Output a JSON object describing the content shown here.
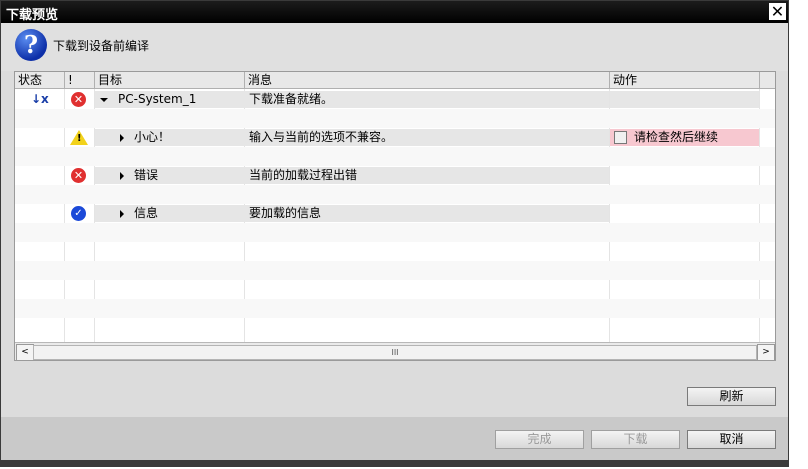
{
  "window": {
    "title": "下载预览",
    "close_glyph": "✕"
  },
  "header": {
    "text": "下载到设备前编译",
    "icon": "question-icon",
    "icon_glyph": "?"
  },
  "table": {
    "columns": [
      "状态",
      "!",
      "目标",
      "消息",
      "动作"
    ],
    "rows": [
      {
        "target": "PC-System_1",
        "message": "下载准备就绪。",
        "severity": "error",
        "expanded": true,
        "status": "download-icon",
        "action": ""
      },
      {
        "target": "",
        "message": "",
        "severity": "",
        "action": ""
      },
      {
        "target": "小心！",
        "message": "输入与当前的选项不兼容。",
        "severity": "warning",
        "expanded": false,
        "action": "请检查然后继续"
      },
      {
        "target": "",
        "message": "",
        "severity": "",
        "action": ""
      },
      {
        "target": "错误",
        "message": "当前的加载过程出错",
        "severity": "error",
        "expanded": false,
        "action": ""
      },
      {
        "target": "",
        "message": "",
        "severity": "",
        "action": ""
      },
      {
        "target": "信息",
        "message": "要加载的信息",
        "severity": "ok",
        "expanded": false,
        "action": ""
      }
    ]
  },
  "scroll": {
    "left": "<",
    "right": ">",
    "thumb": "III"
  },
  "buttons": {
    "refresh": "刷新",
    "finish": "完成",
    "download": "下载",
    "cancel": "取消"
  },
  "colors": {
    "title_bg": "#000000",
    "action_highlight": "#f7c8d0",
    "error": "#e03030",
    "ok": "#1b49d8",
    "warning": "#f2d21b"
  }
}
